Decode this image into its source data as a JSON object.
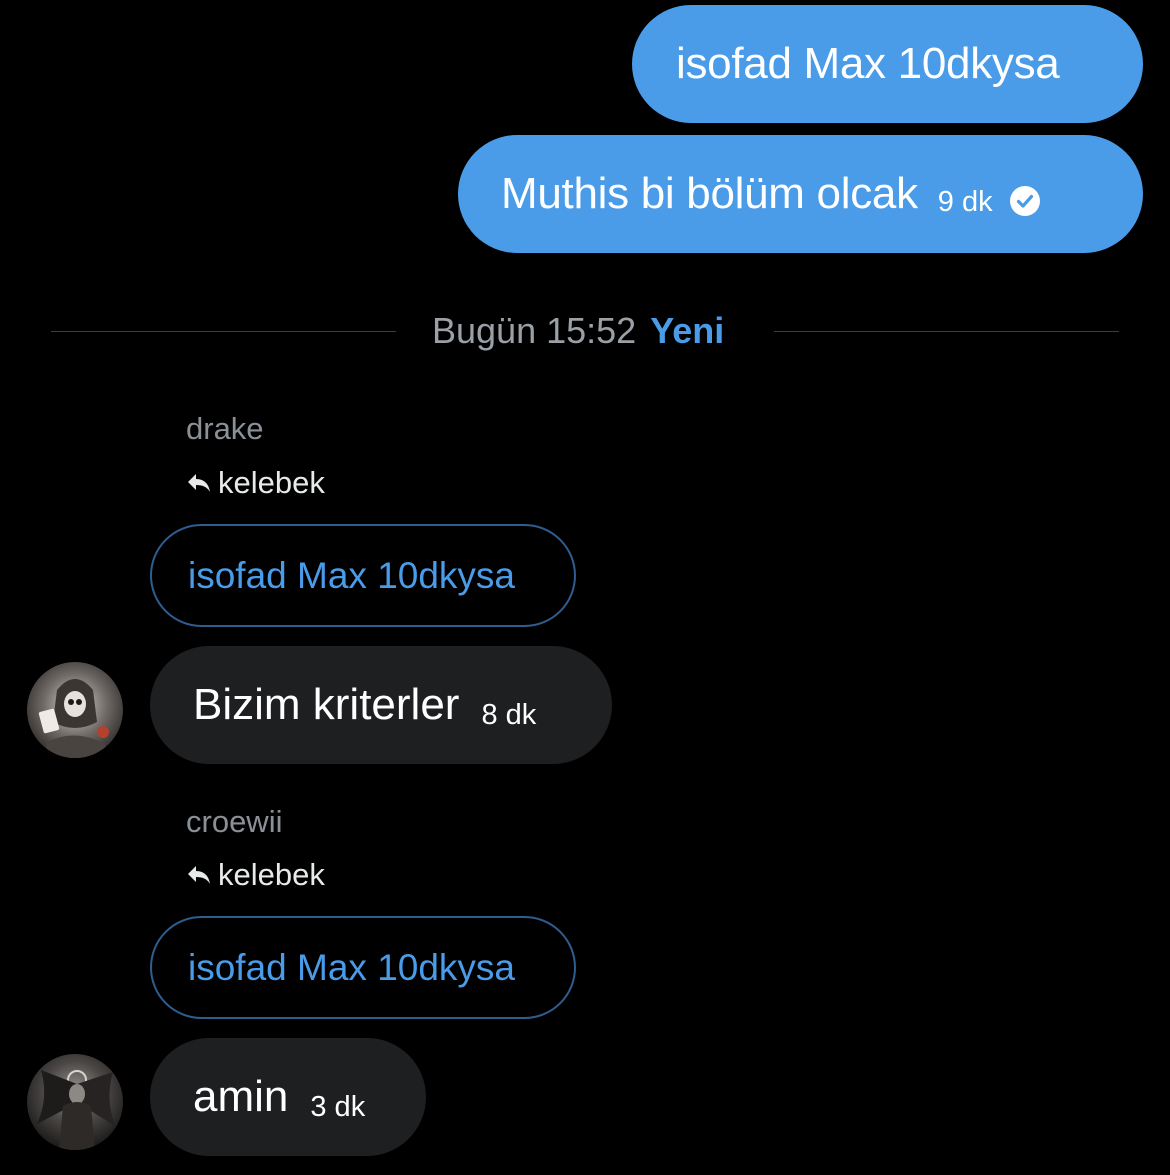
{
  "messages_out": [
    {
      "text": "isofad Max 10dkysa"
    },
    {
      "text": "Muthis bi bölüm olcak",
      "time": "9 dk",
      "status_icon": "read-check-icon"
    }
  ],
  "divider": {
    "date": "Bugün 15:52",
    "new_label": "Yeni"
  },
  "messages_in": [
    {
      "sender": "drake",
      "reply_to": "kelebek",
      "quoted_text": "isofad Max 10dkysa",
      "text": "Bizim kriterler",
      "time": "8 dk"
    },
    {
      "sender": "croewii",
      "reply_to": "kelebek",
      "quoted_text": "isofad Max 10dkysa",
      "text": "amin",
      "time": "3 dk"
    }
  ],
  "colors": {
    "background": "#000000",
    "outgoing_bubble": "#4a9be8",
    "incoming_bubble": "#1e1f21",
    "accent": "#4a9be8",
    "muted_text": "#8b9096",
    "quote_border": "#2f5d8f"
  }
}
